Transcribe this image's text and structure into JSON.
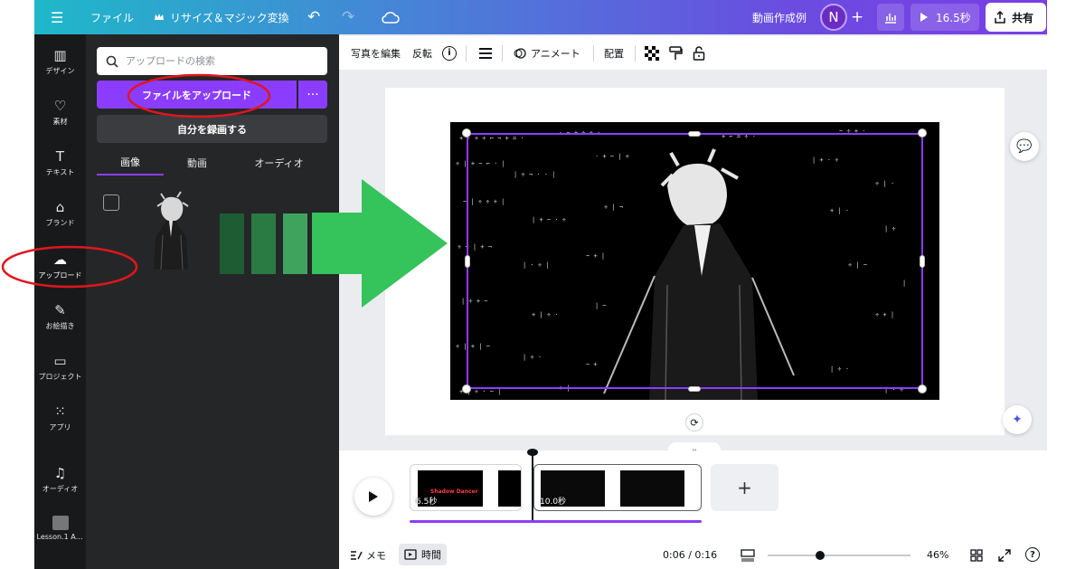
{
  "topbar": {
    "menu_icon": "☰",
    "file_label": "ファイル",
    "resize_label": "リサイズ＆マジック変換",
    "project_title": "動画作成例",
    "avatar_initial": "N",
    "duration_label": "16.5秒",
    "share_label": "共有"
  },
  "rail": {
    "items": [
      {
        "label": "デザイン",
        "icon": "layout-icon"
      },
      {
        "label": "素材",
        "icon": "elements-icon"
      },
      {
        "label": "テキスト",
        "icon": "text-icon"
      },
      {
        "label": "ブランド",
        "icon": "brand-icon"
      },
      {
        "label": "アップロード",
        "icon": "upload-cloud-icon"
      },
      {
        "label": "お絵描き",
        "icon": "draw-icon"
      },
      {
        "label": "プロジェクト",
        "icon": "folder-icon"
      },
      {
        "label": "アプリ",
        "icon": "apps-icon"
      },
      {
        "label": "オーディオ",
        "icon": "music-icon"
      },
      {
        "label": "Lesson.1 A ...",
        "icon": "lesson-thumb"
      }
    ]
  },
  "panel": {
    "search_placeholder": "アップロードの検索",
    "upload_button": "ファイルをアップロード",
    "record_button": "自分を録画する",
    "tabs": [
      "画像",
      "動画",
      "オーディオ"
    ],
    "active_tab": "画像"
  },
  "context_toolbar": {
    "edit_photo": "写真を編集",
    "flip": "反転",
    "animate": "アニメート",
    "position": "配置"
  },
  "timeline": {
    "clips": [
      {
        "duration": "6.5秒",
        "title": "Shadow Dancer"
      },
      {
        "duration": "10.0秒",
        "title": ""
      }
    ]
  },
  "footer": {
    "notes_label": "メモ",
    "timer_label": "時間",
    "time_readout": "0:06 / 0:16",
    "zoom_percent": "46%",
    "zoom_level": 0.36
  },
  "colors": {
    "accent": "#8b3dff",
    "arrow": "#35c35c",
    "annotation": "#e0161e",
    "bar1": "#1e5c34",
    "bar2": "#2a7a44",
    "bar3": "#3fa35e"
  }
}
